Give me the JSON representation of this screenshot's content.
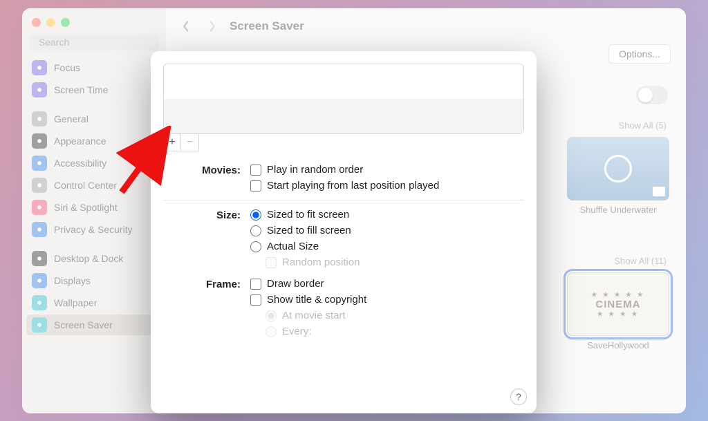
{
  "window": {
    "title": "Screen Saver"
  },
  "search": {
    "placeholder": "Search"
  },
  "sidebar": {
    "items": [
      {
        "label": "Focus",
        "color": "#6e5dd9"
      },
      {
        "label": "Screen Time",
        "color": "#6e5dd9"
      },
      {
        "label": "General",
        "color": "#9a9a9a"
      },
      {
        "label": "Appearance",
        "color": "#2c2c2c"
      },
      {
        "label": "Accessibility",
        "color": "#2a7de1"
      },
      {
        "label": "Control Center",
        "color": "#9a9a9a"
      },
      {
        "label": "Siri & Spotlight",
        "color": "#e9486d"
      },
      {
        "label": "Privacy & Security",
        "color": "#2a7de1"
      },
      {
        "label": "Desktop & Dock",
        "color": "#2c2c2c"
      },
      {
        "label": "Displays",
        "color": "#2a7de1"
      },
      {
        "label": "Wallpaper",
        "color": "#23b6c6"
      },
      {
        "label": "Screen Saver",
        "color": "#23b6c6",
        "selected": true
      }
    ]
  },
  "options_button": "Options...",
  "show_all_a": "Show All (5)",
  "show_all_b": "Show All (11)",
  "thumbs": {
    "a": {
      "label": "Shuffle Underwater"
    },
    "b": {
      "label": "SaveHollywood",
      "word": "CINEMA"
    }
  },
  "sheet": {
    "labels": {
      "movies": "Movies:",
      "size": "Size:",
      "frame": "Frame:"
    },
    "movies": {
      "random": "Play in random order",
      "resume": "Start playing from last position played"
    },
    "size": {
      "fit": "Sized to fit screen",
      "fill": "Sized to fill screen",
      "actual": "Actual Size",
      "random_pos": "Random position"
    },
    "frame": {
      "border": "Draw border",
      "title": "Show title & copyright",
      "at_start": "At movie start",
      "every": "Every:"
    },
    "help": "?"
  }
}
